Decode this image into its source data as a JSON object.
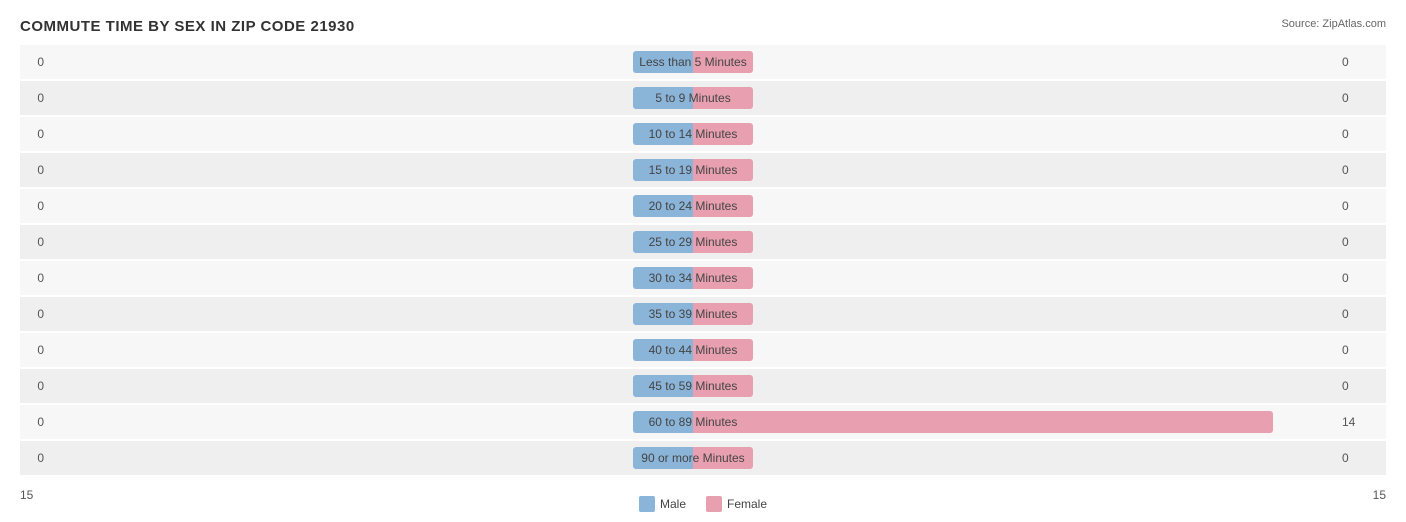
{
  "title": "COMMUTE TIME BY SEX IN ZIP CODE 21930",
  "source": "Source: ZipAtlas.com",
  "rows": [
    {
      "label": "Less than 5 Minutes",
      "male": 0,
      "female": 0,
      "maleWidth": 60,
      "femaleWidth": 60
    },
    {
      "label": "5 to 9 Minutes",
      "male": 0,
      "female": 0,
      "maleWidth": 60,
      "femaleWidth": 60
    },
    {
      "label": "10 to 14 Minutes",
      "male": 0,
      "female": 0,
      "maleWidth": 60,
      "femaleWidth": 60
    },
    {
      "label": "15 to 19 Minutes",
      "male": 0,
      "female": 0,
      "maleWidth": 60,
      "femaleWidth": 60
    },
    {
      "label": "20 to 24 Minutes",
      "male": 0,
      "female": 0,
      "maleWidth": 60,
      "femaleWidth": 60
    },
    {
      "label": "25 to 29 Minutes",
      "male": 0,
      "female": 0,
      "maleWidth": 60,
      "femaleWidth": 60
    },
    {
      "label": "30 to 34 Minutes",
      "male": 0,
      "female": 0,
      "maleWidth": 60,
      "femaleWidth": 60
    },
    {
      "label": "35 to 39 Minutes",
      "male": 0,
      "female": 0,
      "maleWidth": 60,
      "femaleWidth": 60
    },
    {
      "label": "40 to 44 Minutes",
      "male": 0,
      "female": 0,
      "maleWidth": 60,
      "femaleWidth": 60
    },
    {
      "label": "45 to 59 Minutes",
      "male": 0,
      "female": 0,
      "maleWidth": 60,
      "femaleWidth": 60
    },
    {
      "label": "60 to 89 Minutes",
      "male": 0,
      "female": 14,
      "maleWidth": 60,
      "femaleWidth": 580
    },
    {
      "label": "90 or more Minutes",
      "male": 0,
      "female": 0,
      "maleWidth": 60,
      "femaleWidth": 60
    }
  ],
  "legend": {
    "male_label": "Male",
    "female_label": "Female"
  },
  "footer_left": "15",
  "footer_right": "15"
}
